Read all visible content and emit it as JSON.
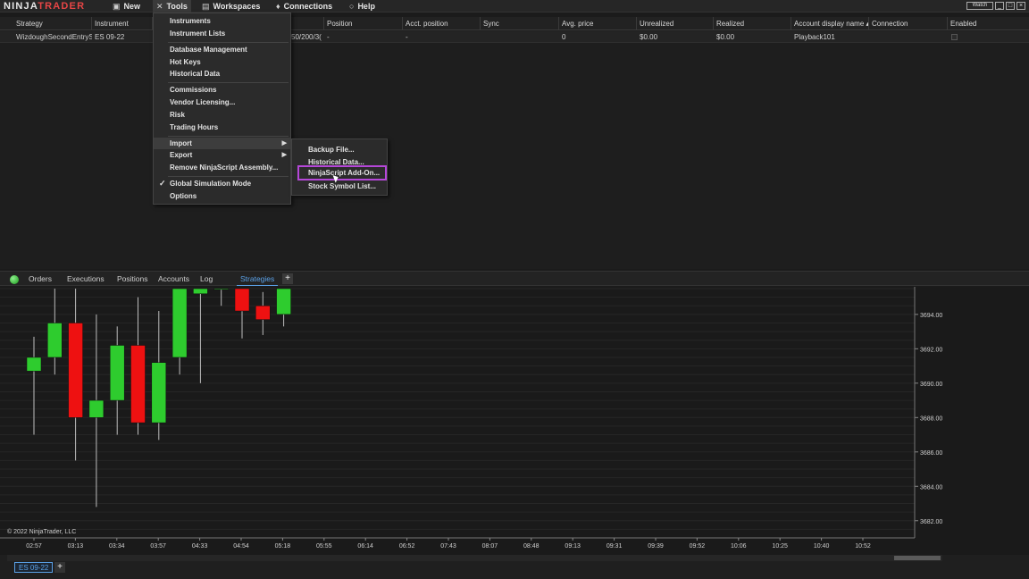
{
  "app": {
    "logo_left": "NINJA",
    "logo_right": "TRADER"
  },
  "menu": {
    "new": "New",
    "tools": "Tools",
    "workspaces": "Workspaces",
    "connections": "Connections",
    "help": "Help"
  },
  "window_buttons": {
    "watch": "Watch",
    "minimize": "_",
    "restore": "□",
    "close": "×"
  },
  "grid": {
    "columns": [
      "Strategy",
      "Instrument",
      "",
      "Position",
      "Acct. position",
      "Sync",
      "Avg. price",
      "Unrealized",
      "Realized",
      "Account display name",
      "Connection",
      "Enabled"
    ],
    "row": {
      "strategy": "WizdoughSecondEntrySt",
      "instrument": "ES 09-22",
      "params": "50/200/3(",
      "position": "-",
      "acct_position": "-",
      "sync": "",
      "avg_price": "0",
      "unrealized": "$0.00",
      "realized": "$0.00",
      "account": "Playback101",
      "connection": ""
    }
  },
  "tools_menu": {
    "items": [
      "Instruments",
      "Instrument Lists",
      "Database Management",
      "Hot Keys",
      "Historical Data",
      "Commissions",
      "Vendor Licensing...",
      "Risk",
      "Trading Hours",
      "Import",
      "Export",
      "Remove NinjaScript Assembly...",
      "Global Simulation Mode",
      "Options"
    ]
  },
  "import_submenu": {
    "items": [
      "Backup File...",
      "Historical Data...",
      "NinjaScript Add-On...",
      "Stock Symbol List..."
    ]
  },
  "tabs": [
    "Orders",
    "Executions",
    "Positions",
    "Accounts",
    "Log",
    "Strategies"
  ],
  "tab_add": "+",
  "chart": {
    "copyright": "© 2022 NinjaTrader, LLC",
    "instrument_tab": "ES 09-22",
    "add_tab": "+"
  },
  "chart_data": {
    "type": "candlestick",
    "x_labels": [
      "02:57",
      "03:13",
      "03:34",
      "03:57",
      "04:33",
      "04:54",
      "05:18",
      "05:55",
      "06:14",
      "06:52",
      "07:43",
      "08:07",
      "08:48",
      "09:13",
      "09:31",
      "09:39",
      "09:52",
      "10:06",
      "10:25",
      "10:40",
      "10:52"
    ],
    "y_ticks": [
      "3694.00",
      "3692.00",
      "3690.00",
      "3688.00",
      "3686.00",
      "3684.00",
      "3682.00"
    ],
    "y_tick_values": [
      3694,
      3692,
      3690,
      3688,
      3686,
      3684,
      3682
    ],
    "ylim": [
      3681.0,
      3695.5
    ],
    "candles": [
      {
        "o": 3690.7,
        "c": 3691.5,
        "h": 3692.7,
        "l": 3687.0
      },
      {
        "o": 3691.5,
        "c": 3693.5,
        "h": 3695.5,
        "l": 3690.5
      },
      {
        "o": 3693.5,
        "c": 3688.0,
        "h": 3695.5,
        "l": 3685.5
      },
      {
        "o": 3688.0,
        "c": 3689.0,
        "h": 3694.0,
        "l": 3682.8
      },
      {
        "o": 3689.0,
        "c": 3692.2,
        "h": 3693.3,
        "l": 3687.0
      },
      {
        "o": 3692.2,
        "c": 3687.7,
        "h": 3695.0,
        "l": 3687.0
      },
      {
        "o": 3687.7,
        "c": 3691.2,
        "h": 3694.2,
        "l": 3686.7
      },
      {
        "o": 3691.5,
        "c": 3695.5,
        "h": 3695.5,
        "l": 3690.5
      },
      {
        "o": 3695.2,
        "c": 3695.5,
        "h": 3695.5,
        "l": 3690.0
      },
      {
        "o": 3695.5,
        "c": 3695.5,
        "h": 3695.5,
        "l": 3694.5
      },
      {
        "o": 3695.5,
        "c": 3694.2,
        "h": 3695.5,
        "l": 3692.6
      },
      {
        "o": 3694.5,
        "c": 3693.7,
        "h": 3695.3,
        "l": 3692.8
      },
      {
        "o": 3694.0,
        "c": 3695.5,
        "h": 3695.5,
        "l": 3693.3
      }
    ],
    "colors": {
      "up": "#2ecc2e",
      "down": "#ee1111"
    }
  },
  "colors": {
    "accent": "#5aa0e6",
    "highlight": "#b547d8",
    "up": "#2ecc2e",
    "down": "#ee1111"
  }
}
